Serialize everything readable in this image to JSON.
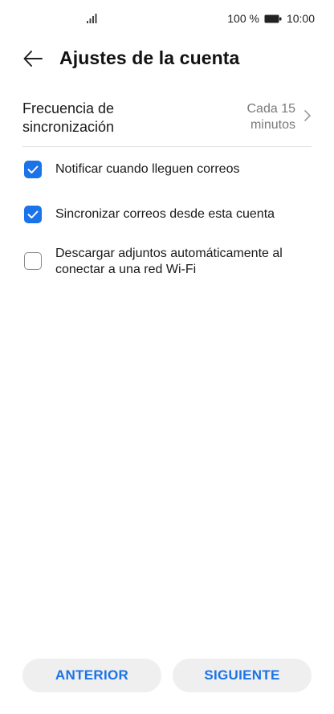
{
  "status_bar": {
    "battery_text": "100 %",
    "time": "10:00",
    "icons": [
      "signal-icon",
      "battery-icon"
    ]
  },
  "header": {
    "title": "Ajustes de la cuenta",
    "back_icon": "arrow-left-icon"
  },
  "sync": {
    "label": "Frecuencia de sincronización",
    "value": "Cada 15 minutos",
    "icon": "chevron-right-icon"
  },
  "options": [
    {
      "label": "Notificar cuando lleguen correos",
      "checked": true
    },
    {
      "label": "Sincronizar correos desde esta cuenta",
      "checked": true
    },
    {
      "label": "Descargar adjuntos automáticamente al conectar a una red Wi-Fi",
      "checked": false
    }
  ],
  "buttons": {
    "previous": "ANTERIOR",
    "next": "SIGUIENTE"
  },
  "colors": {
    "accent": "#1a73e8",
    "button_bg": "#efefef",
    "divider": "#e2e2e2",
    "secondary_text": "#7a7a7a"
  }
}
